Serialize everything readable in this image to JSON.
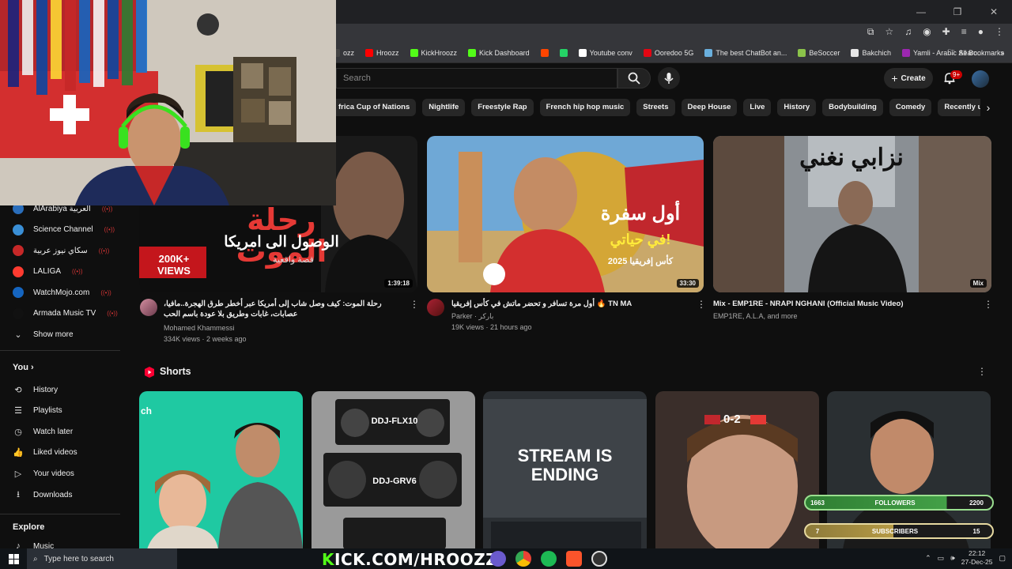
{
  "bookmarks": {
    "items": [
      {
        "label": "ozz",
        "color": "#444"
      },
      {
        "label": "Hroozz",
        "color": "#ff0000"
      },
      {
        "label": "KickHroozz",
        "color": "#53fc18"
      },
      {
        "label": "Kick Dashboard",
        "color": "#53fc18"
      },
      {
        "label": "",
        "color": "#ff4500"
      },
      {
        "label": "",
        "color": "#25d366"
      },
      {
        "label": "Youtube conv",
        "color": "#ffffff"
      },
      {
        "label": "Ooredoo 5G",
        "color": "#e30613"
      },
      {
        "label": "The best ChatBot an...",
        "color": "#6ab0de"
      },
      {
        "label": "BeSoccer",
        "color": "#8bc34a"
      },
      {
        "label": "Bakchich",
        "color": "#e6e6e6"
      },
      {
        "label": "Yamli - Arabic Searc...",
        "color": "#9c27b0"
      }
    ],
    "all_label": "All Bookmarks"
  },
  "header": {
    "search_placeholder": "Search",
    "create_label": "Create",
    "notif_badge": "9+"
  },
  "chips": [
    "frica Cup of Nations",
    "Nightlife",
    "Freestyle Rap",
    "French hip hop music",
    "Streets",
    "Deep House",
    "Live",
    "History",
    "Bodybuilding",
    "Comedy",
    "Recently uploaded"
  ],
  "sidebar": {
    "subscriptions": [
      {
        "label": "AlArabiya العربية",
        "color": "#2a6ebb"
      },
      {
        "label": "Science Channel",
        "color": "#3a8fd6"
      },
      {
        "label": "سكاي نيوز عربية",
        "color": "#c62828"
      },
      {
        "label": "LALIGA",
        "color": "#ff3b30"
      },
      {
        "label": "WatchMojo.com",
        "color": "#1565c0"
      },
      {
        "label": "Armada Music TV",
        "color": "#111111"
      }
    ],
    "show_more": "Show more",
    "you_heading": "You",
    "you_items": [
      {
        "label": "History",
        "icon": "history-icon",
        "glyph": "⟲"
      },
      {
        "label": "Playlists",
        "icon": "playlists-icon",
        "glyph": "☰"
      },
      {
        "label": "Watch later",
        "icon": "clock-icon",
        "glyph": "◷"
      },
      {
        "label": "Liked videos",
        "icon": "thumbs-up-icon",
        "glyph": "👍"
      },
      {
        "label": "Your videos",
        "icon": "play-square-icon",
        "glyph": "▷"
      },
      {
        "label": "Downloads",
        "icon": "download-icon",
        "glyph": "⭳"
      }
    ],
    "explore_heading": "Explore",
    "explore_items": [
      {
        "label": "Music"
      }
    ]
  },
  "videos": [
    {
      "thumb_title_ar": "رحلة الموت",
      "thumb_sub_ar": "الوصول الى امريكا",
      "thumb_tag_ar": "قصة واقعية",
      "views_badge": "200K+ VIEWS",
      "duration": "1:39:18",
      "title": "رحلة الموت: كيف وصل شاب إلى أمريكا عبر أخطر طرق الهجرة..مافيا، عصابات، غابات وطريق بلا عودة باسم الحب",
      "channel": "Mohamed Khammessi",
      "stats": "334K views · 2 weeks ago"
    },
    {
      "thumb_title_ar": "أول سفرة",
      "thumb_sub_ar": "في حياتي!",
      "thumb_tag_ar": "كأس إفريقيا 2025",
      "duration": "33:30",
      "title": "أول مرة تسافر و تحضر ماتش في كأس إفريقيا 🔥 TN MA",
      "channel": "Parker · باركر",
      "stats": "19K views · 21 hours ago"
    },
    {
      "thumb_title_ar": "نزابي نغني",
      "duration": "Mix",
      "title": "Mix - EMP1RE - NRAPI NGHANI (Official Music Video)",
      "channel": "EMP1RE, A.L.A, and more",
      "stats": ""
    }
  ],
  "shorts": {
    "title": "Shorts",
    "items": [
      {
        "overlay": "ch"
      },
      {
        "overlay": "DDJ-FLX10",
        "overlay2": "DDJ-GRV6"
      },
      {
        "overlay": "STREAM IS ENDING"
      },
      {
        "overlay": "0-2"
      },
      {
        "overlay": ""
      }
    ]
  },
  "stream_widget": {
    "followers_label": "FOLLOWERS",
    "followers_current": "1663",
    "followers_goal": "2200",
    "followers_progress": 0.756,
    "subscribers_label": "SUBSCRIBERS",
    "subscribers_current": "7",
    "subscribers_goal": "15",
    "subscribers_progress": 0.47
  },
  "taskbar": {
    "search_placeholder": "Type here to search",
    "kick_prefix": "K",
    "kick_text": "ICK.COM/HROOZZ",
    "time": "22:12",
    "date": "27-Dec-25"
  }
}
